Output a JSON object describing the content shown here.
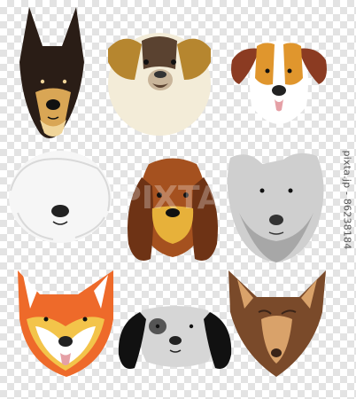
{
  "image": {
    "watermark_text": "pixta.jp - 86238184",
    "center_watermark": "PIXTA"
  },
  "dogs": [
    {
      "breed": "doberman",
      "colors": [
        "#2a1d16",
        "#d9a655",
        "#f0d59a"
      ]
    },
    {
      "breed": "bulldog",
      "colors": [
        "#f3ecd8",
        "#b6862f",
        "#5a4230"
      ]
    },
    {
      "breed": "beagle",
      "colors": [
        "#ffffff",
        "#e0962d",
        "#8b3b22"
      ]
    },
    {
      "breed": "old-english-sheepdog",
      "colors": [
        "#f6f6f6",
        "#d9d9d9",
        "#222222"
      ]
    },
    {
      "breed": "bloodhound",
      "colors": [
        "#a5511f",
        "#6e3315",
        "#e7b13a"
      ]
    },
    {
      "breed": "schnauzer",
      "colors": [
        "#cfcfcf",
        "#a7a7a7",
        "#333333"
      ]
    },
    {
      "breed": "shiba-fox",
      "colors": [
        "#ee6a2a",
        "#ffffff",
        "#f3c44a"
      ]
    },
    {
      "breed": "spaniel",
      "colors": [
        "#111111",
        "#d6d6d6",
        "#555555"
      ]
    },
    {
      "breed": "chihuahua",
      "colors": [
        "#7a4a2a",
        "#d9a26a",
        "#3a2418"
      ]
    }
  ]
}
